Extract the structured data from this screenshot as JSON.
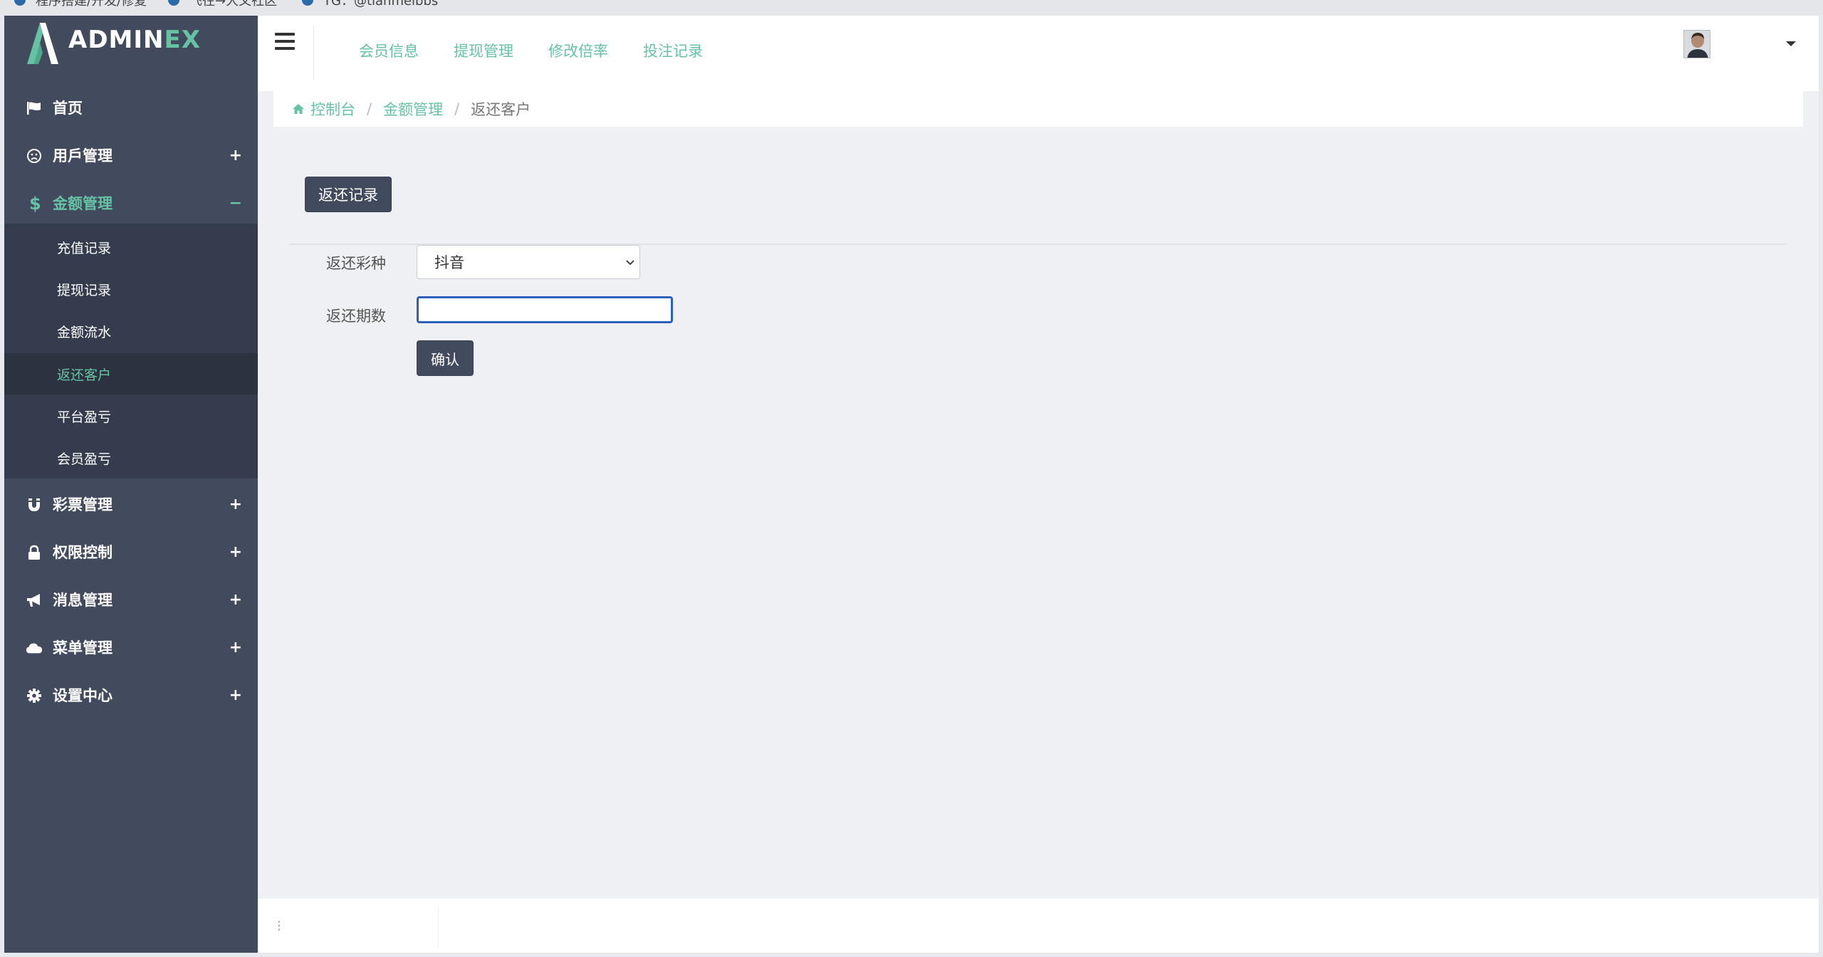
{
  "bookmarks": [
    {
      "label": "程序搭建/开发/修复"
    },
    {
      "label": "飞往→大文社区"
    },
    {
      "label": "TG：@tianmeibbs"
    }
  ],
  "logo": {
    "part1": "ADMIN",
    "part2": "EX"
  },
  "sidebar": {
    "items": [
      {
        "label": "首页",
        "icon": "flag-icon",
        "toggle": ""
      },
      {
        "label": "用戶管理",
        "icon": "user-circle-icon",
        "toggle": "+"
      },
      {
        "label": "金额管理",
        "icon": "dollar-icon",
        "toggle": "−"
      },
      {
        "label": "彩票管理",
        "icon": "magnet-icon",
        "toggle": "+"
      },
      {
        "label": "权限控制",
        "icon": "lock-icon",
        "toggle": "+"
      },
      {
        "label": "消息管理",
        "icon": "bullhorn-icon",
        "toggle": "+"
      },
      {
        "label": "菜单管理",
        "icon": "cloud-icon",
        "toggle": "+"
      },
      {
        "label": "设置中心",
        "icon": "gear-icon",
        "toggle": "+"
      }
    ],
    "sub_items": [
      {
        "label": "充值记录"
      },
      {
        "label": "提现记录"
      },
      {
        "label": "金额流水"
      },
      {
        "label": "返还客户"
      },
      {
        "label": "平台盈亏"
      },
      {
        "label": "会员盈亏"
      }
    ]
  },
  "header": {
    "links": [
      "会员信息",
      "提现管理",
      "修改倍率",
      "投注记录"
    ]
  },
  "breadcrumb": {
    "home": "控制台",
    "parent": "金额管理",
    "current": "返还客户",
    "separator": "/"
  },
  "main": {
    "records_button": "返还记录",
    "lottery_label": "返还彩种",
    "lottery_value": "抖音",
    "period_label": "返还期数",
    "period_value": "",
    "confirm_button": "确认"
  },
  "footer": {
    "text": "⋮"
  },
  "colors": {
    "sidebar_bg": "#424a5d",
    "submenu_bg": "#353c4d",
    "accent": "#65c3a4",
    "button_dark": "#424a5d"
  }
}
